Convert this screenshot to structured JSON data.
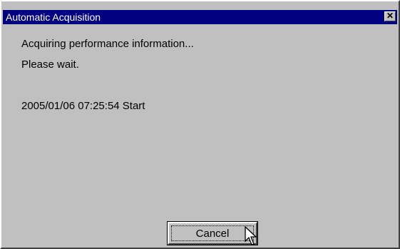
{
  "window": {
    "title": "Automatic Acquisition",
    "close_glyph": "✕"
  },
  "message": {
    "line1": "Acquiring performance information...",
    "line2": "Please wait.",
    "start_line": "2005/01/06 07:25:54 Start"
  },
  "buttons": {
    "cancel_label": "Cancel"
  },
  "icons": {
    "close": "close-icon",
    "cursor": "mouse-pointer-icon"
  },
  "colors": {
    "titlebar": "#000080",
    "face": "#c0c0c0"
  }
}
